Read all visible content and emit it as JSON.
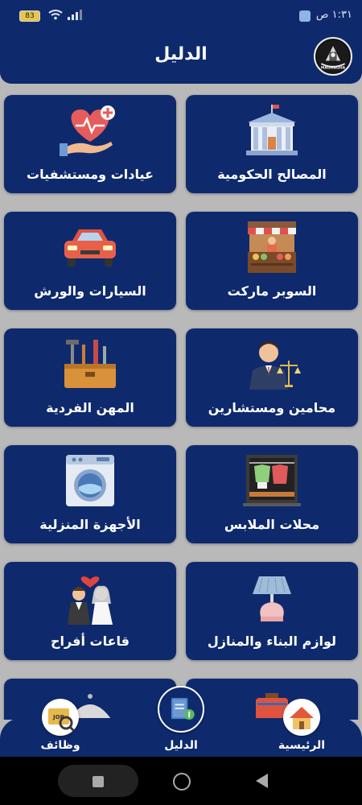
{
  "status_bar": {
    "time": "١:٣١ ص",
    "battery": "83"
  },
  "header": {
    "title": "الدليل",
    "logo_text": "MAGHAGHA"
  },
  "cards": [
    {
      "label": "المصالح الحكومية",
      "icon": "government-building-icon"
    },
    {
      "label": "عيادات ومستشفيات",
      "icon": "heart-hand-icon"
    },
    {
      "label": "السوبر ماركت",
      "icon": "market-stall-icon"
    },
    {
      "label": "السيارات والورش",
      "icon": "car-icon"
    },
    {
      "label": "محامين ومستشارين",
      "icon": "lawyer-scales-icon"
    },
    {
      "label": "المهن الفردية",
      "icon": "toolbox-icon"
    },
    {
      "label": "محلات الملابس",
      "icon": "clothes-rack-icon"
    },
    {
      "label": "الأجهزة المنزلية",
      "icon": "washing-machine-icon"
    },
    {
      "label": "لوازم البناء والمنازل",
      "icon": "lamp-icon"
    },
    {
      "label": "قاعات أفراح",
      "icon": "wedding-couple-icon"
    },
    {
      "label": "",
      "icon": "suitcase-icon"
    },
    {
      "label": "",
      "icon": "dish-cover-icon"
    }
  ],
  "bottom_nav": {
    "home": "الرئيسية",
    "guide": "الدليل",
    "jobs": "وظائف"
  },
  "colors": {
    "primary": "#0e2a6d",
    "background": "#b9b9b9"
  }
}
